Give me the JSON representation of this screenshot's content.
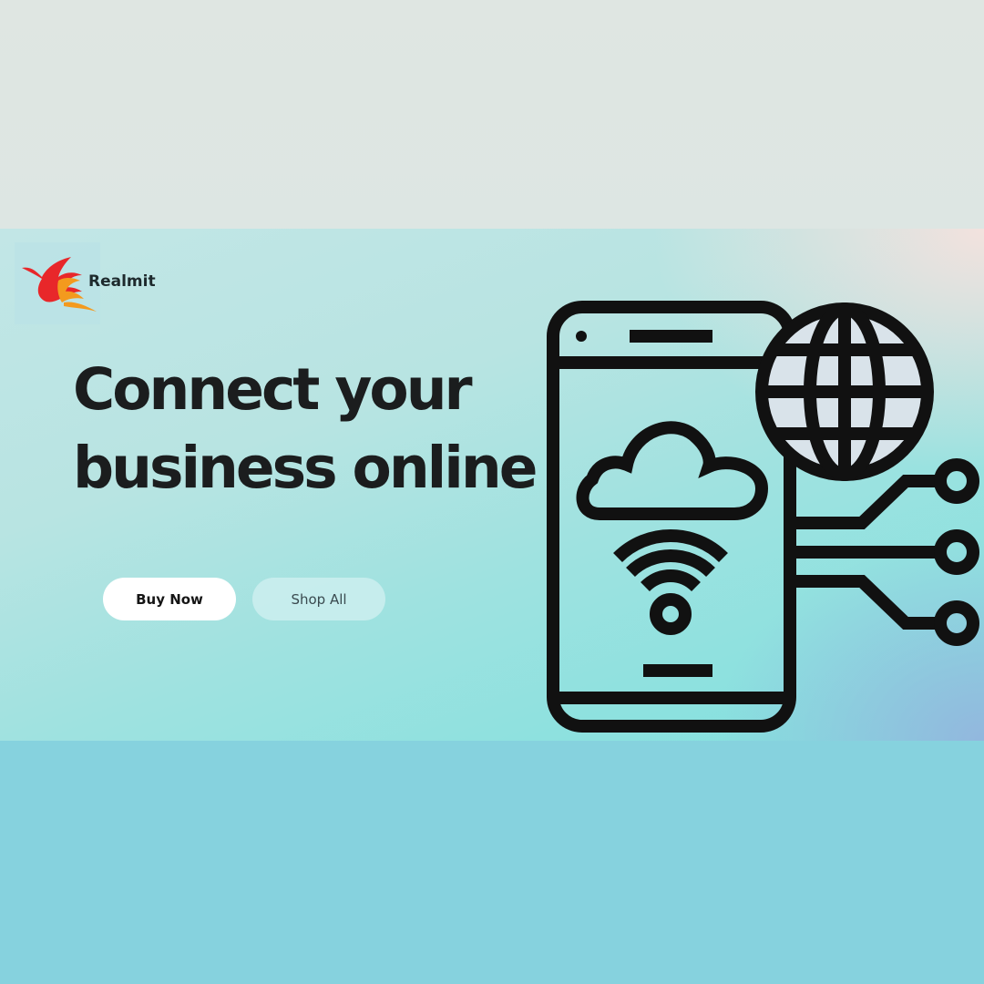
{
  "brand": {
    "name": "Realmit",
    "logo_icon": "phoenix-bird-icon",
    "logo_colors": {
      "red": "#e8272a",
      "orange": "#f39a1e"
    }
  },
  "hero": {
    "headline_line1": "Connect your",
    "headline_line2": "business online"
  },
  "buttons": {
    "buy_now": "Buy Now",
    "shop_all": "Shop All"
  },
  "illustration": {
    "icons": [
      "smartphone-icon",
      "globe-icon",
      "cloud-icon",
      "wifi-icon",
      "circuit-icon"
    ],
    "stroke_color": "#111111"
  },
  "colors": {
    "top_band": "#dde6e3",
    "hero_teal": "#9fe2e0",
    "bottom_band": "#86d2de",
    "headline": "#1b1d1e"
  }
}
